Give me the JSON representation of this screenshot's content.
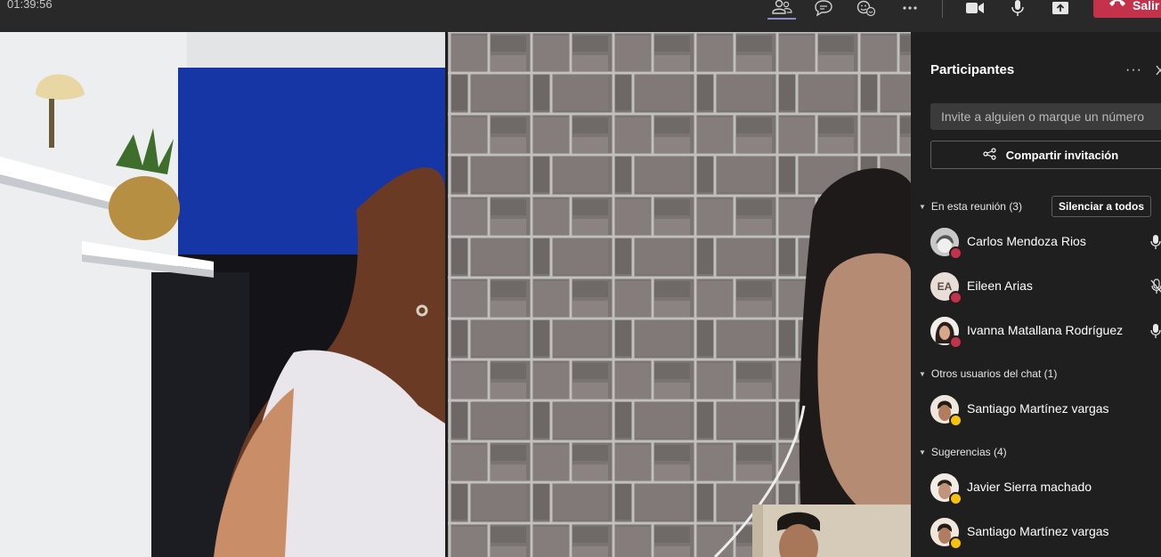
{
  "toolbar": {
    "timer": "01:39:56",
    "icons": [
      "participants-icon",
      "chat-icon",
      "reactions-icon",
      "more-options-icon",
      "camera-icon",
      "microphone-icon",
      "share-screen-icon"
    ],
    "leave_label": "Salir",
    "colors": {
      "background": "#292929",
      "leave": "#c4314b",
      "active_indicator": "#8b8cc7"
    }
  },
  "panel": {
    "title": "Participantes",
    "invite_placeholder": "Invite a alguien o marque un número",
    "share_label": "Compartir invitación",
    "mute_all_label": "Silenciar a todos",
    "sections": [
      {
        "label": "En esta reunión (3)",
        "participants": [
          {
            "name": "Carlos Mendoza Rios",
            "status": "red",
            "mic": "on"
          },
          {
            "name": "Eileen Arias",
            "initials": "EA",
            "status": "red",
            "mic": "muted"
          },
          {
            "name": "Ivanna Matallana Rodríguez",
            "status": "red",
            "mic": "on"
          }
        ]
      },
      {
        "label": "Otros usuarios del chat (1)",
        "participants": [
          {
            "name": "Santiago Martínez vargas",
            "status": "yellow"
          }
        ]
      },
      {
        "label": "Sugerencias (4)",
        "participants": [
          {
            "name": "Javier Sierra machado",
            "status": "yellow"
          },
          {
            "name": "Santiago Martínez vargas",
            "status": "yellow"
          }
        ]
      }
    ]
  }
}
